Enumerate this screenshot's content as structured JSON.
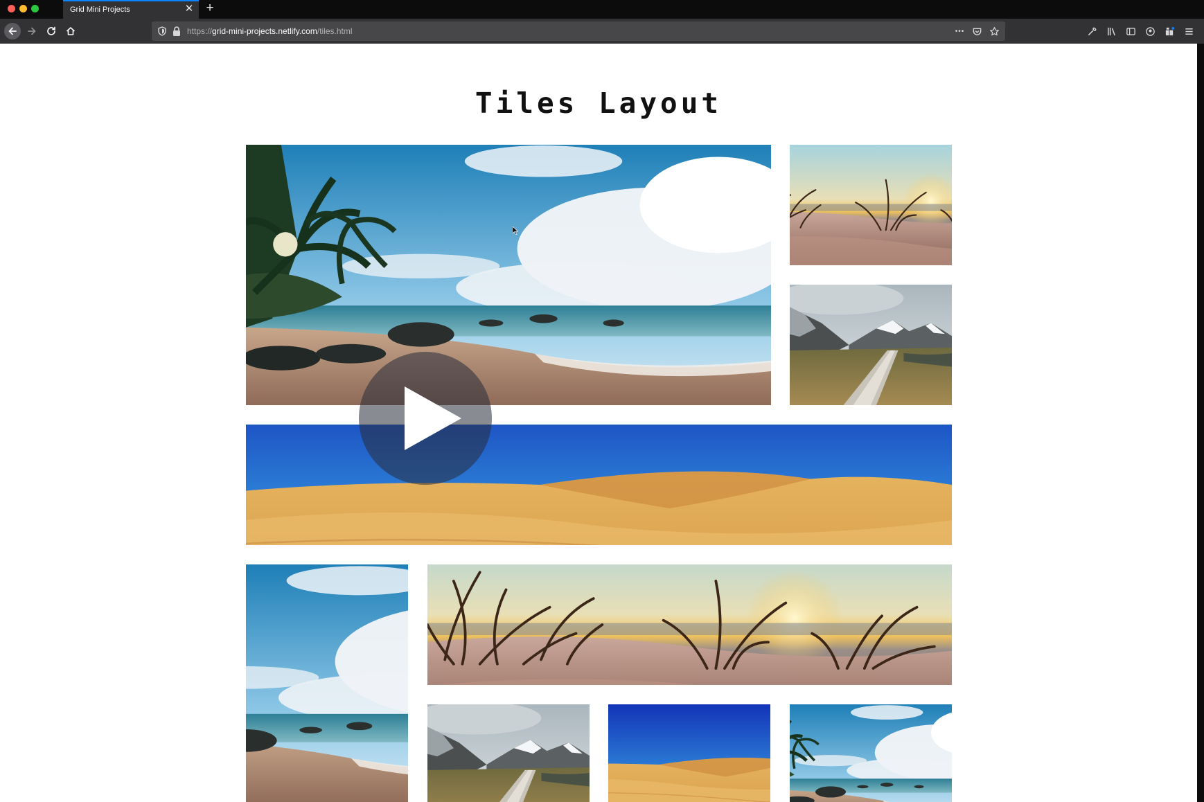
{
  "browser": {
    "tab_title": "Grid Mini Projects",
    "tab_close": "✕",
    "new_tab": "+",
    "url_scheme": "https://",
    "url_host": "grid-mini-projects.netlify.com",
    "url_path": "/tiles.html",
    "url_more": "•••"
  },
  "page": {
    "title": "Tiles Layout"
  },
  "tiles": [
    {
      "scene": "tropical-beach",
      "desc": "Palm trees, beach, sea"
    },
    {
      "scene": "sunset-dunes-grass",
      "desc": "Dune grass at sunset"
    },
    {
      "scene": "mountain-boardwalk",
      "desc": "Boardwalk in mountain valley"
    },
    {
      "scene": "desert-dunes",
      "desc": "Desert sand dunes"
    },
    {
      "scene": "tropical-beach",
      "desc": "Palm trees, beach"
    },
    {
      "scene": "sunset-dunes-grass",
      "desc": "Dune grass at sunset"
    },
    {
      "scene": "mountain-boardwalk",
      "desc": "Mountain valley path"
    },
    {
      "scene": "desert-dunes",
      "desc": "Desert dune"
    },
    {
      "scene": "tropical-beach",
      "desc": "Palm beach"
    }
  ],
  "overlay": {
    "icon": "play-icon"
  },
  "colors": {
    "accent": "#0a84ff",
    "chrome": "#323234",
    "urlbar": "#474749"
  }
}
